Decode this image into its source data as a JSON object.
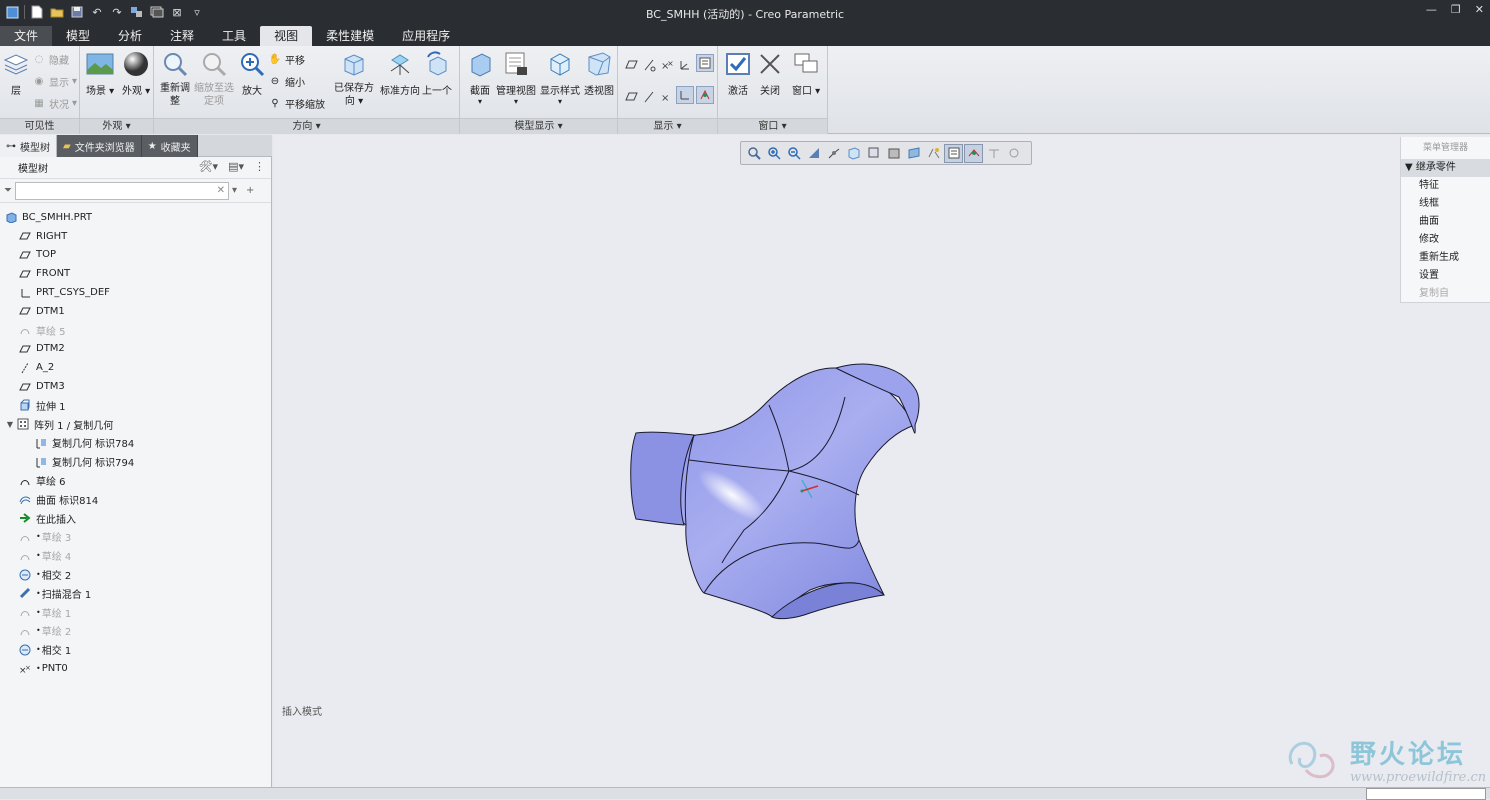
{
  "window": {
    "title": "BC_SMHH (活动的) - Creo Parametric"
  },
  "quick_access": {
    "icons": [
      "app-icon",
      "new-icon",
      "open-icon",
      "save-icon",
      "undo-icon",
      "redo-icon",
      "regenerate-icon",
      "windows-icon",
      "close-window-icon",
      "customize-icon"
    ]
  },
  "tabs": [
    "文件",
    "模型",
    "分析",
    "注释",
    "工具",
    "视图",
    "柔性建模",
    "应用程序"
  ],
  "active_tab": "视图",
  "ribbon": {
    "visibility": {
      "label": "可见性",
      "layer": "层",
      "hide": "隐藏",
      "show": "显示",
      "status": "状况"
    },
    "appearance": {
      "label": "外观",
      "scene": "场景",
      "appearance": "外观"
    },
    "orientation": {
      "label": "方向",
      "refit": "重新调整",
      "zoom_to_selected": "缩放至选定项",
      "zoom_in": "放大",
      "pan": "平移",
      "zoom_out": "缩小",
      "pan_zoom": "平移缩放",
      "saved_orientations": "已保存方向",
      "standard_orientation": "标准方向",
      "previous": "上一个"
    },
    "model_display": {
      "label": "模型显示",
      "section": "截面",
      "manage_views": "管理视图",
      "display_style": "显示样式",
      "perspective": "透视图"
    },
    "display": {
      "label": "显示"
    },
    "window": {
      "label": "窗口",
      "activate": "激活",
      "close": "关闭",
      "windows": "窗口"
    }
  },
  "nav_tabs": [
    "模型树",
    "文件夹浏览器",
    "收藏夹"
  ],
  "model_tree": {
    "header": "模型树",
    "filter_placeholder": "",
    "items": [
      {
        "label": "BC_SMHH.PRT",
        "icon": "part-icon",
        "disabled": false
      },
      {
        "label": "RIGHT",
        "icon": "datum-plane-icon",
        "disabled": false
      },
      {
        "label": "TOP",
        "icon": "datum-plane-icon",
        "disabled": false
      },
      {
        "label": "FRONT",
        "icon": "datum-plane-icon",
        "disabled": false
      },
      {
        "label": "PRT_CSYS_DEF",
        "icon": "csys-icon",
        "disabled": false
      },
      {
        "label": "DTM1",
        "icon": "datum-plane-icon",
        "disabled": false
      },
      {
        "label": "草绘 5",
        "icon": "sketch-icon",
        "disabled": true
      },
      {
        "label": "DTM2",
        "icon": "datum-plane-icon",
        "disabled": false
      },
      {
        "label": "A_2",
        "icon": "axis-icon",
        "disabled": false
      },
      {
        "label": "DTM3",
        "icon": "datum-plane-icon",
        "disabled": false
      },
      {
        "label": "拉伸 1",
        "icon": "extrude-icon",
        "disabled": false
      },
      {
        "label": "阵列 1 / 复制几何",
        "icon": "pattern-icon",
        "disabled": false
      },
      {
        "label": "复制几何 标识784",
        "icon": "copy-geom-icon",
        "disabled": false
      },
      {
        "label": "复制几何 标识794",
        "icon": "copy-geom-icon",
        "disabled": false
      },
      {
        "label": "草绘 6",
        "icon": "sketch-icon",
        "disabled": false
      },
      {
        "label": "曲面 标识814",
        "icon": "surface-icon",
        "disabled": false
      },
      {
        "label": "在此插入",
        "icon": "insert-here-icon",
        "disabled": false
      },
      {
        "label": "草绘 3",
        "icon": "sketch-icon",
        "disabled": true
      },
      {
        "label": "草绘 4",
        "icon": "sketch-icon",
        "disabled": true
      },
      {
        "label": "相交 2",
        "icon": "intersect-icon",
        "disabled": false
      },
      {
        "label": "扫描混合 1",
        "icon": "swept-blend-icon",
        "disabled": false
      },
      {
        "label": "草绘 1",
        "icon": "sketch-icon",
        "disabled": true
      },
      {
        "label": "草绘 2",
        "icon": "sketch-icon",
        "disabled": true
      },
      {
        "label": "相交 1",
        "icon": "intersect-icon",
        "disabled": false
      },
      {
        "label": "PNT0",
        "icon": "datum-point-icon",
        "disabled": false
      }
    ]
  },
  "graphics": {
    "insert_mode": "插入模式"
  },
  "menu_manager": {
    "title": "菜单管理器",
    "section": "继承零件",
    "items": [
      {
        "label": "特征",
        "disabled": false
      },
      {
        "label": "线框",
        "disabled": false
      },
      {
        "label": "曲面",
        "disabled": false
      },
      {
        "label": "修改",
        "disabled": false
      },
      {
        "label": "重新生成",
        "disabled": false
      },
      {
        "label": "设置",
        "disabled": false
      },
      {
        "label": "复制自",
        "disabled": true
      }
    ]
  },
  "watermark": {
    "text": "野火论坛",
    "url": "www.proewildfire.cn"
  },
  "status": {
    "message": ""
  }
}
